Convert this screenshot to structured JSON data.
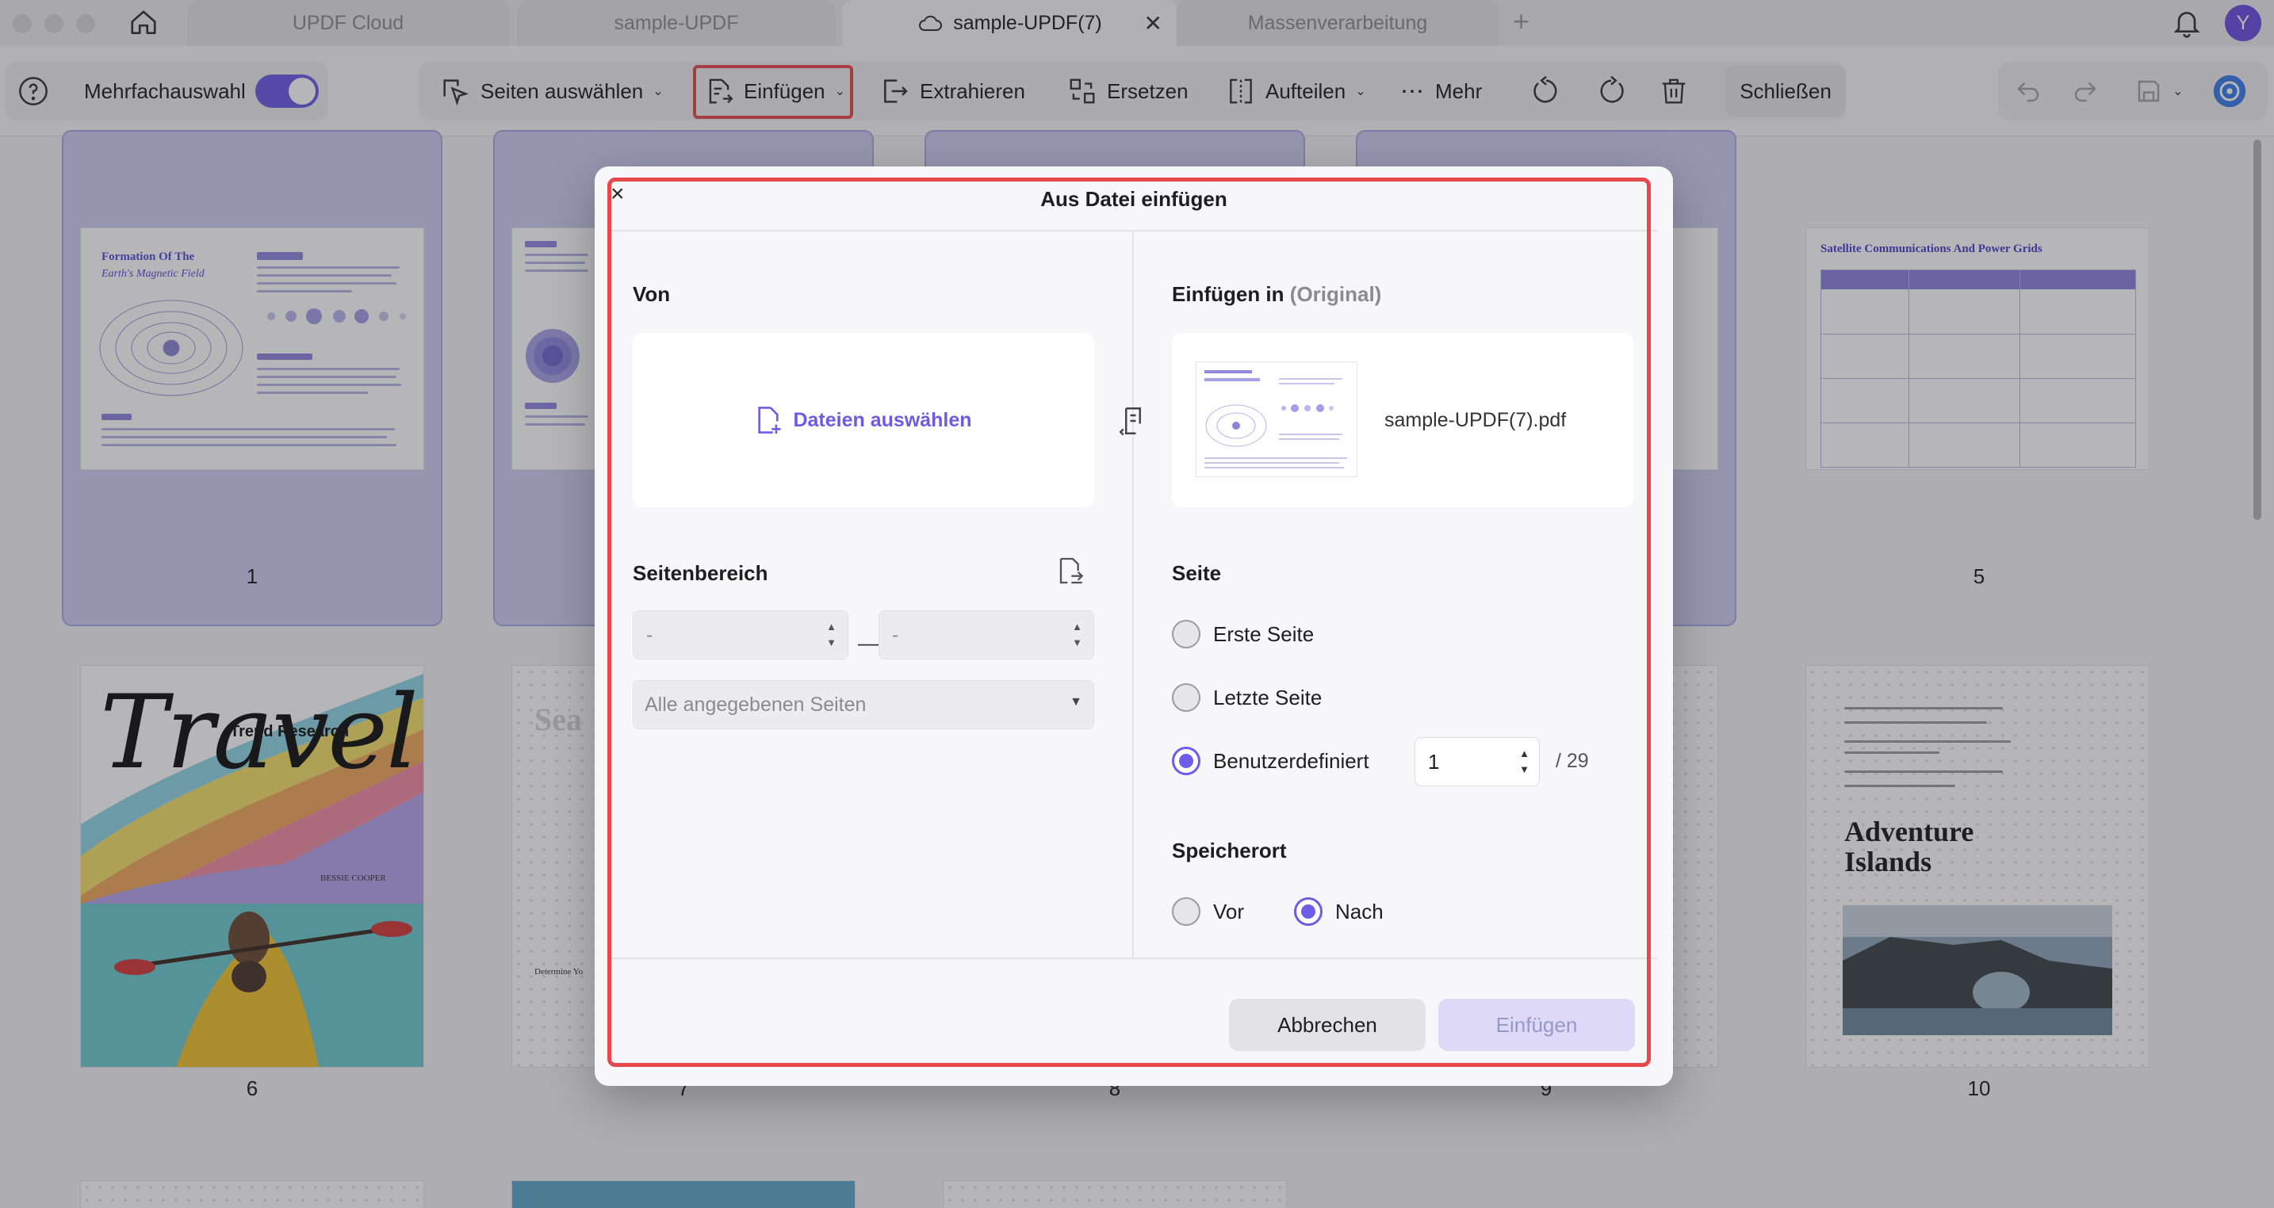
{
  "tabs": [
    {
      "label": "UPDF Cloud",
      "active": false
    },
    {
      "label": "sample-UPDF",
      "active": false
    },
    {
      "label": "sample-UPDF(7)",
      "active": true
    },
    {
      "label": "Massenverarbeitung",
      "active": false
    }
  ],
  "tab_close": "✕",
  "tab_add": "+",
  "user_initial": "Y",
  "toolbar": {
    "multi_select_label": "Mehrfachauswahl",
    "select_pages_label": "Seiten auswählen",
    "insert_label": "Einfügen",
    "extract_label": "Extrahieren",
    "replace_label": "Ersetzen",
    "split_label": "Aufteilen",
    "more_label": "Mehr",
    "close_label": "Schließen"
  },
  "pages": {
    "p1": {
      "num": "1",
      "title": "Formation Of The",
      "subtitle": "Earth's Magnetic Field"
    },
    "p5": {
      "num": "5",
      "title": "Satellite Communications And Power Grids"
    },
    "p6": {
      "num": "6",
      "word": "Travel",
      "trend": "Trend Research",
      "author": "BESSIE COOPER"
    },
    "p7": {
      "num": "7",
      "word": "Sea",
      "heading": "Determine Yo"
    },
    "p8": {
      "num": "8"
    },
    "p9": {
      "num": "9"
    },
    "p10": {
      "num": "10",
      "title_line1": "Adventure",
      "title_line2": "Islands"
    }
  },
  "modal": {
    "close": "×",
    "title": "Aus Datei einfügen",
    "from_label": "Von",
    "choose_files": "Dateien auswählen",
    "insert_into_label": "Einfügen in",
    "insert_into_note": "(Original)",
    "file_name": "sample-UPDF(7).pdf",
    "page_range_label": "Seitenbereich",
    "range_from": "-",
    "range_to": "-",
    "range_dash": "—",
    "range_select": "Alle angegebenen Seiten",
    "page_label": "Seite",
    "first_page": "Erste Seite",
    "last_page": "Letzte Seite",
    "custom": "Benutzerdefiniert",
    "custom_value": "1",
    "total_pages": "/ 29",
    "location_label": "Speicherort",
    "before": "Vor",
    "after": "Nach",
    "cancel_button": "Abbrechen",
    "insert_button": "Einfügen",
    "selected_page_option": "Benutzerdefiniert",
    "selected_location": "Nach"
  },
  "colors": {
    "accent": "#6c5ce7",
    "highlight": "#e5484d",
    "selection": "#cfcdf2"
  }
}
